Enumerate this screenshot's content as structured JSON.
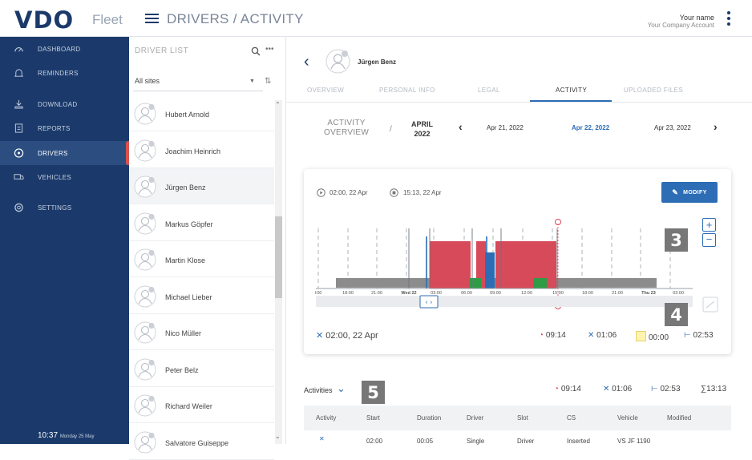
{
  "app": {
    "logo": "VDO",
    "product": "Fleet",
    "title": "DRIVERS / ACTIVITY"
  },
  "user": {
    "name": "Your name",
    "account": "Your Company Account"
  },
  "sidebar": {
    "items": [
      {
        "label": "DASHBOARD",
        "icon": "speedometer-icon"
      },
      {
        "label": "REMINDERS",
        "icon": "bell-icon"
      },
      {
        "label": "DOWNLOAD",
        "icon": "download-icon"
      },
      {
        "label": "REPORTS",
        "icon": "report-icon"
      },
      {
        "label": "DRIVERS",
        "icon": "steering-wheel-icon",
        "active": true
      },
      {
        "label": "VEHICLES",
        "icon": "truck-icon"
      },
      {
        "label": "SETTINGS",
        "icon": "gear-icon"
      }
    ],
    "clock": {
      "time": "10:37",
      "date": "Monday 25 May"
    }
  },
  "driver_list": {
    "heading": "DRIVER LIST",
    "site_filter": "All sites",
    "drivers": [
      "Hubert Arnold",
      "Joachim Heinrich",
      "Jürgen Benz",
      "Markus Göpfer",
      "Martin Klose",
      "Michael Lieber",
      "Nico Müller",
      "Peter Belz",
      "Richard Weiler",
      "Salvatore Guiseppe"
    ],
    "selected": "Jürgen Benz"
  },
  "main": {
    "driver_name": "Jürgen Benz",
    "tabs": [
      "OVERVIEW",
      "PERSONAL INFO",
      "LEGAL",
      "ACTIVITY",
      "UPLOADED FILES"
    ],
    "active_tab": "ACTIVITY",
    "date_nav": {
      "overview_label_1": "ACTIVITY",
      "overview_label_2": "OVERVIEW",
      "slash": "/",
      "month": "APRIL",
      "year": "2022",
      "dates": [
        "Apr 21, 2022",
        "Apr 22, 2022",
        "Apr 23, 2022"
      ],
      "selected_date": "Apr 22, 2022"
    },
    "card": {
      "start_time": "02:00, 22 Apr",
      "end_time": "15:13, 22 Apr",
      "modify_label": "MODIFY",
      "zoom_in": "+",
      "zoom_out": "−",
      "cursor": "02:00, 22 Apr",
      "summary": {
        "driving": "09:14",
        "work": "01:06",
        "available": "00:00",
        "rest": "02:53"
      }
    },
    "badges": [
      "3",
      "4",
      "5"
    ],
    "activities": {
      "label": "Activities",
      "summary": {
        "driving": "09:14",
        "work": "01:06",
        "rest": "02:53",
        "total": "∑13:13"
      },
      "columns": [
        "Activity",
        "Start",
        "Duration",
        "Driver",
        "Slot",
        "CS",
        "Vehicle",
        "Modified"
      ],
      "first_row": {
        "start": "02:00",
        "duration": "00:05",
        "driver": "Single",
        "slot": "Driver",
        "cs": "Inserted",
        "vehicle": "VS JF 1190"
      }
    }
  },
  "chart_data": {
    "type": "timeline",
    "tick_labels": [
      "l:00",
      "18:00",
      "21:00",
      "Wed 22",
      "03:00",
      "06:00",
      "09:00",
      "12:00",
      "15:00",
      "18:00",
      "21:00",
      "Thu 23",
      "03:00"
    ],
    "colors": {
      "driving": "#d64a5a",
      "work": "#2d6db5",
      "available": "#2e9b45",
      "rest": "#8c8c8c"
    }
  }
}
